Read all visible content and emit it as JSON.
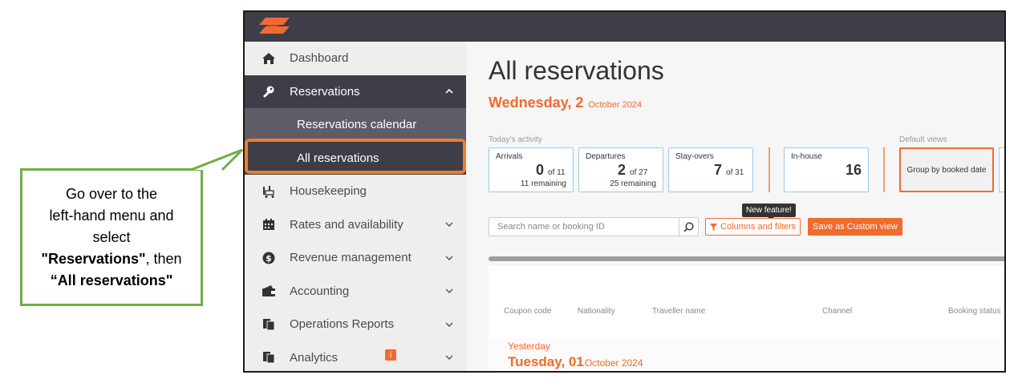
{
  "callout": {
    "line1": "Go over to the",
    "line2": "left-hand menu and",
    "line3": "select",
    "line4_bold": "\"Reservations\"",
    "line4_rest": ", then",
    "line5_bold": "“All reservations\""
  },
  "colors": {
    "accent": "#ef6b2e",
    "callout_border": "#70ad47",
    "highlight": "#ed7d31",
    "topbar": "#3d3e47"
  },
  "sidebar": {
    "items": [
      {
        "label": "Dashboard",
        "icon": "home-icon"
      },
      {
        "label": "Reservations",
        "icon": "key-icon"
      },
      {
        "label": "Housekeeping",
        "icon": "housekeeping-cart-icon"
      },
      {
        "label": "Rates and availability",
        "icon": "calendar-icon"
      },
      {
        "label": "Revenue management",
        "icon": "dollar-circle-icon"
      },
      {
        "label": "Accounting",
        "icon": "wallet-icon"
      },
      {
        "label": "Operations Reports",
        "icon": "reports-icon"
      },
      {
        "label": "Analytics",
        "icon": "analytics-icon"
      }
    ],
    "sub": {
      "calendar": "Reservations calendar",
      "all": "All reservations"
    },
    "analytics_badge": "i"
  },
  "main": {
    "title": "All reservations",
    "date_big": "Wednesday, 2",
    "date_small": "October 2024",
    "activity_label": "Today's activity",
    "default_views_label": "Default views",
    "cards": {
      "arrivals": {
        "label": "Arrivals",
        "num": "0",
        "of": "of 11",
        "remaining": "11 remaining"
      },
      "departures": {
        "label": "Departures",
        "num": "2",
        "of": "of 27",
        "remaining": "25 remaining"
      },
      "stayovers": {
        "label": "Stay-overs",
        "num": "7",
        "of": "of 31"
      },
      "inhouse": {
        "label": "In-house",
        "num": "16"
      }
    },
    "view_card": "Group by booked date",
    "tooltip": "New feature!",
    "search_placeholder": "Search name or booking ID",
    "filter_button": "Columns and filters",
    "save_button": "Save as Custom view",
    "columns": [
      "Coupon code",
      "Nationality",
      "Traveller name",
      "Channel",
      "Booking status"
    ],
    "group": {
      "label": "Yesterday",
      "date_big": "Tuesday, 01",
      "date_small": "October 2024"
    }
  }
}
